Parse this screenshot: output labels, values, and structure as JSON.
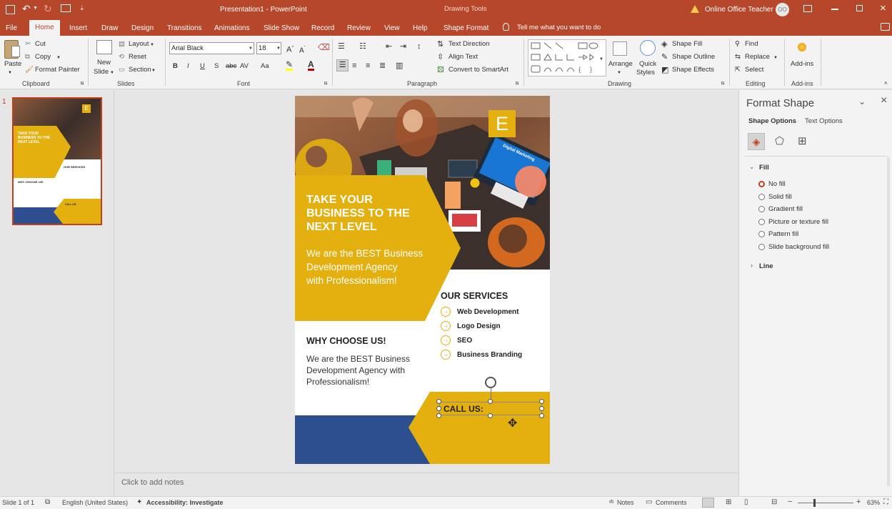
{
  "titlebar": {
    "doc_title": "Presentation1 - PowerPoint",
    "context_label": "Drawing Tools",
    "warning_text": "Online Office Teacher",
    "avatar_initials": "OO"
  },
  "tabs": [
    {
      "label": "File"
    },
    {
      "label": "Home"
    },
    {
      "label": "Insert"
    },
    {
      "label": "Draw"
    },
    {
      "label": "Design"
    },
    {
      "label": "Transitions"
    },
    {
      "label": "Animations"
    },
    {
      "label": "Slide Show"
    },
    {
      "label": "Record"
    },
    {
      "label": "Review"
    },
    {
      "label": "View"
    },
    {
      "label": "Help"
    },
    {
      "label": "Shape Format"
    }
  ],
  "tell_me": "Tell me what you want to do",
  "ribbon": {
    "clipboard": {
      "paste": "Paste",
      "cut": "Cut",
      "copy": "Copy",
      "format_painter": "Format Painter",
      "group": "Clipboard"
    },
    "slides": {
      "new_slide": "New",
      "new_slide2": "Slide",
      "layout": "Layout",
      "reset": "Reset",
      "section": "Section",
      "group": "Slides"
    },
    "font": {
      "name": "Arial Black",
      "size": "18",
      "group": "Font"
    },
    "paragraph": {
      "text_direction": "Text Direction",
      "align_text": "Align Text",
      "smartart": "Convert to SmartArt",
      "group": "Paragraph"
    },
    "drawing": {
      "arrange": "Arrange",
      "quick_styles": "Quick",
      "quick_styles2": "Styles",
      "shape_fill": "Shape Fill",
      "shape_outline": "Shape Outline",
      "shape_effects": "Shape Effects",
      "group": "Drawing"
    },
    "editing": {
      "find": "Find",
      "replace": "Replace",
      "select": "Select",
      "group": "Editing"
    },
    "addins": {
      "label": "Add-ins",
      "group": "Add-ins"
    }
  },
  "thumb": {
    "number": "1"
  },
  "slide": {
    "logo_letter": "E",
    "headline": [
      "TAKE YOUR",
      "BUSINESS TO THE",
      "NEXT LEVEL"
    ],
    "tagline": [
      "We are the BEST Business",
      "Development Agency",
      "with Professionalism!"
    ],
    "services_title": "OUR SERVICES",
    "services": [
      {
        "label": "Web Development"
      },
      {
        "label": "Logo Design"
      },
      {
        "label": "SEO"
      },
      {
        "label": "Business Branding"
      }
    ],
    "why_title": "WHY CHOOSE US!",
    "why_body": [
      "We are the BEST Business",
      "Development Agency with",
      "Professionalism!"
    ],
    "call_us": "CALL US:",
    "monitor_text": "Digital Marketing"
  },
  "thumb_text": {
    "headline": [
      "TAKE YOUR",
      "BUSINESS TO THE",
      "NEXT LEVEL"
    ],
    "services": "OUR SERVICES",
    "why": "WHY CHOOSE US!",
    "call": "CALL US:"
  },
  "notes_placeholder": "Click to add notes",
  "format_pane": {
    "title": "Format Shape",
    "tab_shape": "Shape Options",
    "tab_text": "Text Options",
    "fill_section": "Fill",
    "line_section": "Line",
    "fill_options": [
      {
        "label": "No fill",
        "selected": true
      },
      {
        "label": "Solid fill",
        "selected": false
      },
      {
        "label": "Gradient fill",
        "selected": false
      },
      {
        "label": "Picture or texture fill",
        "selected": false
      },
      {
        "label": "Pattern fill",
        "selected": false
      },
      {
        "label": "Slide background fill",
        "selected": false
      }
    ]
  },
  "status": {
    "slide_of": "Slide 1 of 1",
    "language": "English (United States)",
    "accessibility": "Accessibility: Investigate",
    "notes": "Notes",
    "comments": "Comments",
    "zoom": "63%"
  },
  "colors": {
    "accent": "#b7472a",
    "gold": "#e3b00f",
    "navy": "#2e4f8f"
  }
}
